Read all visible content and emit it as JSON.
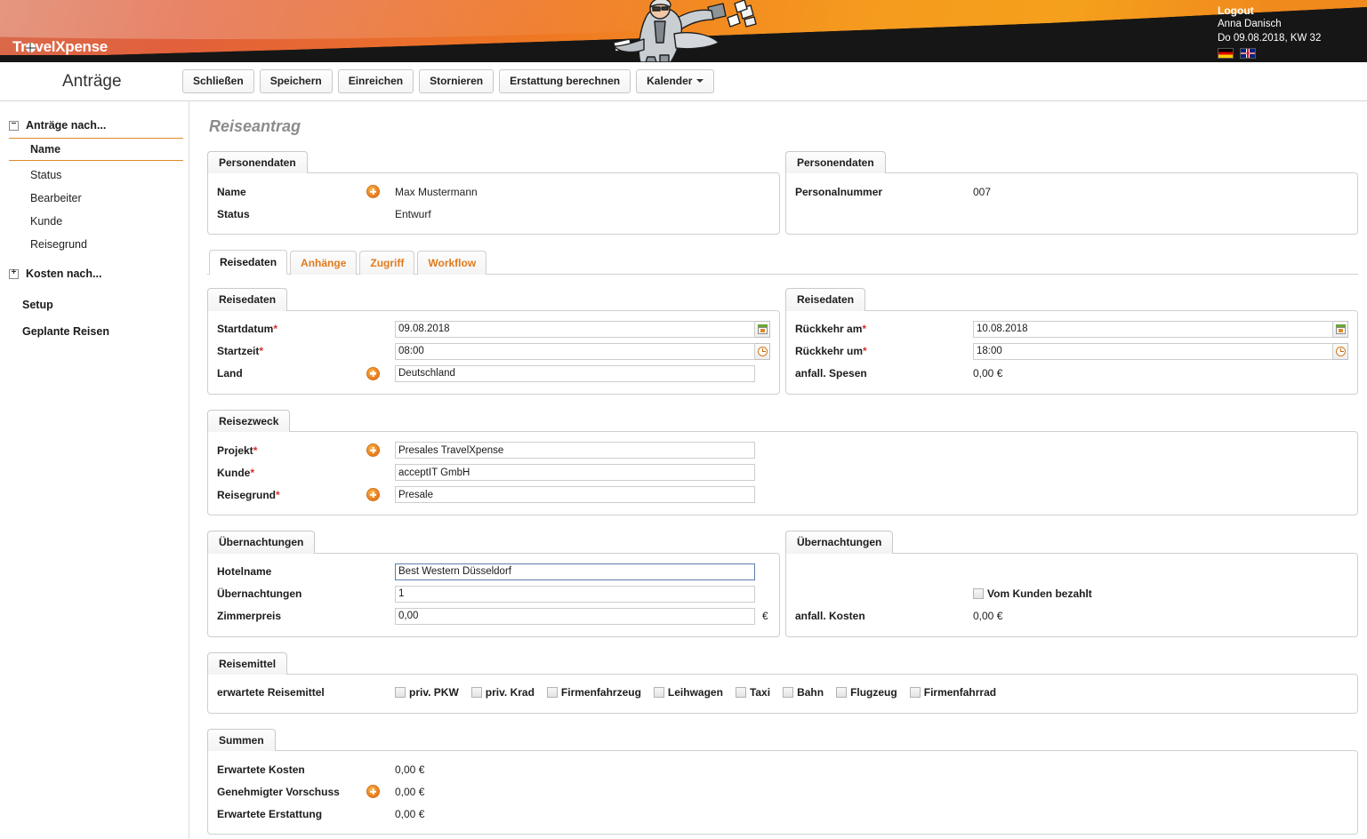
{
  "banner": {
    "logo_text": "TravelXpense",
    "logo_part1": "Tr",
    "logo_part2": "vel",
    "logo_part3": "Xpense",
    "mascot_icon": "running-businessman-icon"
  },
  "user": {
    "logout_label": "Logout",
    "name": "Anna Danisch",
    "date": "Do 09.08.2018, KW 32",
    "flag_de": "german-flag-icon",
    "flag_en": "english-flag-icon"
  },
  "header": {
    "page_title": "Anträge"
  },
  "toolbar": {
    "buttons": [
      {
        "label": "Schließen",
        "name": "close-button"
      },
      {
        "label": "Speichern",
        "name": "save-button"
      },
      {
        "label": "Einreichen",
        "name": "submit-button"
      },
      {
        "label": "Stornieren",
        "name": "cancel-button"
      },
      {
        "label": "Erstattung berechnen",
        "name": "calculate-reimbursement-button"
      }
    ],
    "dropdown": {
      "label": "Kalender",
      "name": "calendar-dropdown"
    }
  },
  "sidebar": {
    "group1": {
      "label": "Anträge nach...",
      "toggle": "−",
      "items": [
        {
          "label": "Name",
          "active": true
        },
        {
          "label": "Status",
          "active": false
        },
        {
          "label": "Bearbeiter",
          "active": false
        },
        {
          "label": "Kunde",
          "active": false
        },
        {
          "label": "Reisegrund",
          "active": false
        }
      ]
    },
    "group2": {
      "label": "Kosten nach...",
      "toggle": "+"
    },
    "standalone": [
      {
        "label": "Setup"
      },
      {
        "label": "Geplante Reisen"
      }
    ]
  },
  "main": {
    "form_title": "Reiseantrag",
    "personendaten_left": {
      "tab": "Personendaten",
      "rows": [
        {
          "label": "Name",
          "value": "Max Mustermann",
          "has_plus": true
        },
        {
          "label": "Status",
          "value": "Entwurf",
          "has_plus": false
        }
      ]
    },
    "personendaten_right": {
      "tab": "Personendaten",
      "rows": [
        {
          "label": "Personalnummer",
          "value": "007"
        }
      ]
    },
    "tabs": [
      {
        "label": "Reisedaten",
        "active": true
      },
      {
        "label": "Anhänge",
        "active": false
      },
      {
        "label": "Zugriff",
        "active": false
      },
      {
        "label": "Workflow",
        "active": false
      }
    ],
    "reisedaten_left": {
      "tab": "Reisedaten",
      "startdatum_label": "Startdatum",
      "startdatum_value": "09.08.2018",
      "startzeit_label": "Startzeit",
      "startzeit_value": "08:00",
      "land_label": "Land",
      "land_value": "Deutschland"
    },
    "reisedaten_right": {
      "tab": "Reisedaten",
      "rueckkehr_am_label": "Rückkehr am",
      "rueckkehr_am_value": "10.08.2018",
      "rueckkehr_um_label": "Rückkehr um",
      "rueckkehr_um_value": "18:00",
      "spesen_label": "anfall. Spesen",
      "spesen_value": "0,00 €"
    },
    "reisezweck": {
      "tab": "Reisezweck",
      "projekt_label": "Projekt",
      "projekt_value": "Presales TravelXpense",
      "kunde_label": "Kunde",
      "kunde_value": "acceptIT GmbH",
      "reisegrund_label": "Reisegrund",
      "reisegrund_value": "Presale"
    },
    "uebernachtungen_left": {
      "tab": "Übernachtungen",
      "hotelname_label": "Hotelname",
      "hotelname_value": "Best Western Düsseldorf",
      "naechte_label": "Übernachtungen",
      "naechte_value": "1",
      "zimmerpreis_label": "Zimmerpreis",
      "zimmerpreis_value": "0,00",
      "euro": "€"
    },
    "uebernachtungen_right": {
      "tab": "Übernachtungen",
      "checkbox_label": "Vom Kunden bezahlt",
      "checkbox_checked": false,
      "kosten_label": "anfall. Kosten",
      "kosten_value": "0,00 €"
    },
    "reisemittel": {
      "tab": "Reisemittel",
      "label": "erwartete Reisemittel",
      "options": [
        {
          "label": "priv. PKW",
          "checked": false
        },
        {
          "label": "priv. Krad",
          "checked": false
        },
        {
          "label": "Firmenfahrzeug",
          "checked": false
        },
        {
          "label": "Leihwagen",
          "checked": false
        },
        {
          "label": "Taxi",
          "checked": false
        },
        {
          "label": "Bahn",
          "checked": false
        },
        {
          "label": "Flugzeug",
          "checked": false
        },
        {
          "label": "Firmenfahrrad",
          "checked": false
        }
      ]
    },
    "summen": {
      "tab": "Summen",
      "rows": [
        {
          "label": "Erwartete Kosten",
          "value": "0,00 €",
          "has_plus": false
        },
        {
          "label": "Genehmigter Vorschuss",
          "value": "0,00 €",
          "has_plus": true
        },
        {
          "label": "Erwartete Erstattung",
          "value": "0,00 €",
          "has_plus": false
        }
      ]
    }
  },
  "colors": {
    "accent_orange": "#e07b1e",
    "banner_dark": "#161616",
    "required_red": "#d6302a"
  }
}
